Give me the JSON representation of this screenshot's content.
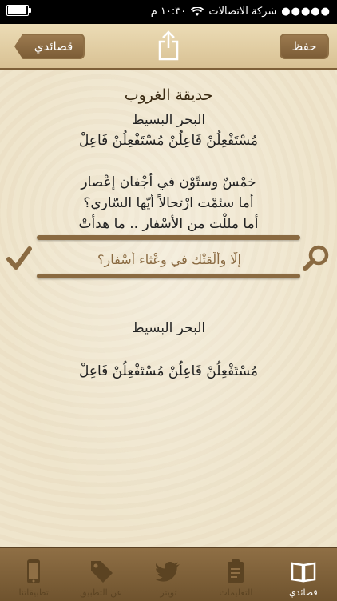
{
  "status_bar": {
    "carrier": "شركة الاتصالات",
    "time": "١٠:٣٠ م",
    "battery_level": 0.95
  },
  "nav_bar": {
    "back_label": "قصائدي",
    "save_label": "حفظ"
  },
  "poem": {
    "title": "حديقة الغروب",
    "meter_name": "البحر البسيط",
    "meter_pattern": "مُسْتَفْعِلُنْ فَاعِلُنْ مُسْتَفْعِلُنْ فَاعِلْ",
    "verses": [
      "خمْسٌ وستّوْن في أجْفان إعْصار",
      "أما سئمْت ارْتحالاً أيّها السّاري؟",
      "أما مللْت من الأسْفار .. ما هدأتْ"
    ]
  },
  "search": {
    "value": "إلّا وألْقتْك في وعْثاء أسْفار؟"
  },
  "result": {
    "meter_name": "البحر البسيط",
    "meter_pattern": "مُسْتَفْعِلُنْ فَاعِلُنْ مُسْتَفْعِلُنْ فَاعِلْ"
  },
  "tab_bar": {
    "tabs": [
      {
        "label": "قصائدي",
        "icon": "book-icon",
        "active": true
      },
      {
        "label": "التعليمات",
        "icon": "clipboard-icon",
        "active": false
      },
      {
        "label": "تويتر",
        "icon": "twitter-bird-icon",
        "active": false
      },
      {
        "label": "عن التطبيق",
        "icon": "tag-icon",
        "active": false
      },
      {
        "label": "تطبيقاتنا",
        "icon": "phone-icon",
        "active": false
      }
    ]
  },
  "colors": {
    "accent_brown": "#8a6a41",
    "parchment": "#efe5cc",
    "tab_bar": "#7d5e37"
  }
}
